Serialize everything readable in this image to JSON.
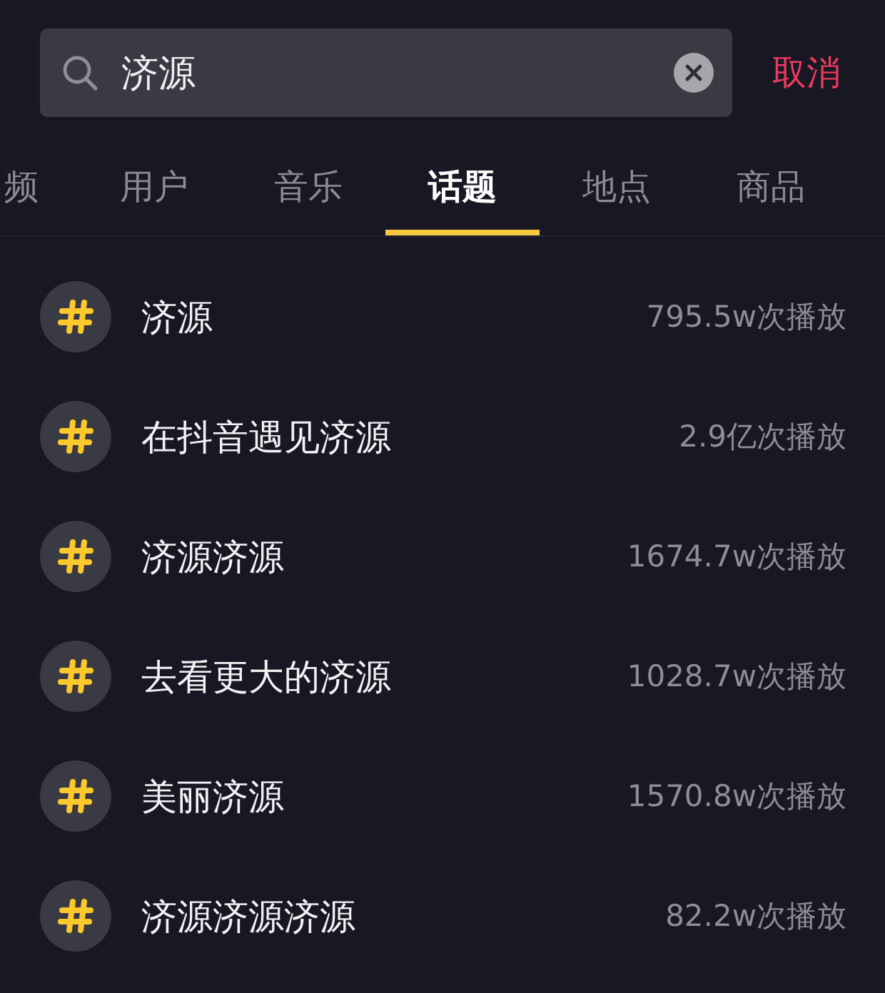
{
  "search": {
    "value": "济源",
    "cancel": "取消"
  },
  "tabs": [
    {
      "label": "频",
      "selected": false
    },
    {
      "label": "用户",
      "selected": false
    },
    {
      "label": "音乐",
      "selected": false
    },
    {
      "label": "话题",
      "selected": true
    },
    {
      "label": "地点",
      "selected": false
    },
    {
      "label": "商品",
      "selected": false
    }
  ],
  "topics": [
    {
      "title": "济源",
      "plays": "795.5w次播放"
    },
    {
      "title": "在抖音遇见济源",
      "plays": "2.9亿次播放"
    },
    {
      "title": "济源济源",
      "plays": "1674.7w次播放"
    },
    {
      "title": "去看更大的济源",
      "plays": "1028.7w次播放"
    },
    {
      "title": "美丽济源",
      "plays": "1570.8w次播放"
    },
    {
      "title": "济源济源济源",
      "plays": "82.2w次播放"
    }
  ]
}
